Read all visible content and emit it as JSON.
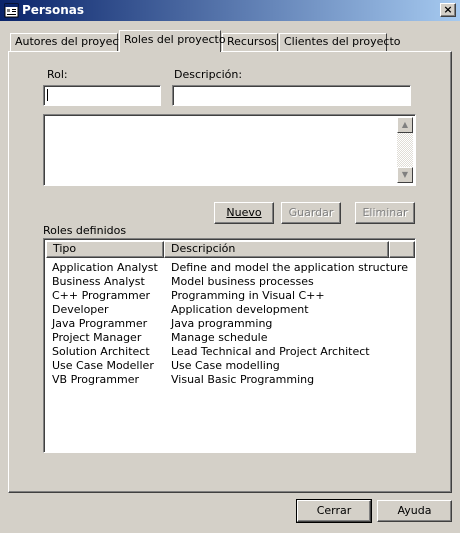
{
  "window": {
    "title": "Personas",
    "close_label": "×"
  },
  "tabs": [
    {
      "label": "Autores del proyecto"
    },
    {
      "label": "Roles del proyecto"
    },
    {
      "label": "Recursos"
    },
    {
      "label": "Clientes del proyecto"
    }
  ],
  "form": {
    "rol_label": "Rol:",
    "rol_value": "",
    "descripcion_label": "Descripción:",
    "descripcion_value": "",
    "notes_value": ""
  },
  "actions": {
    "nuevo_label": "Nuevo",
    "guardar_label": "Guardar",
    "eliminar_label": "Eliminar"
  },
  "roles_list": {
    "title": "Roles definidos",
    "columns": [
      "Tipo",
      "Descripción"
    ],
    "rows": [
      {
        "tipo": "Application Analyst",
        "descripcion": "Define and model the application structure"
      },
      {
        "tipo": "Business Analyst",
        "descripcion": "Model business processes"
      },
      {
        "tipo": "C++ Programmer",
        "descripcion": "Programming in Visual C++"
      },
      {
        "tipo": "Developer",
        "descripcion": "Application development"
      },
      {
        "tipo": "Java Programmer",
        "descripcion": "Java programming"
      },
      {
        "tipo": "Project Manager",
        "descripcion": "Manage schedule"
      },
      {
        "tipo": "Solution Architect",
        "descripcion": "Lead Technical and Project Architect"
      },
      {
        "tipo": "Use Case Modeller",
        "descripcion": "Use Case modelling"
      },
      {
        "tipo": "VB Programmer",
        "descripcion": "Visual Basic Programming"
      }
    ]
  },
  "footer": {
    "cerrar_label": "Cerrar",
    "ayuda_label": "Ayuda"
  },
  "colors": {
    "titlebar_start": "#0a246a",
    "titlebar_end": "#a6caf0",
    "face": "#d4d0c8"
  }
}
